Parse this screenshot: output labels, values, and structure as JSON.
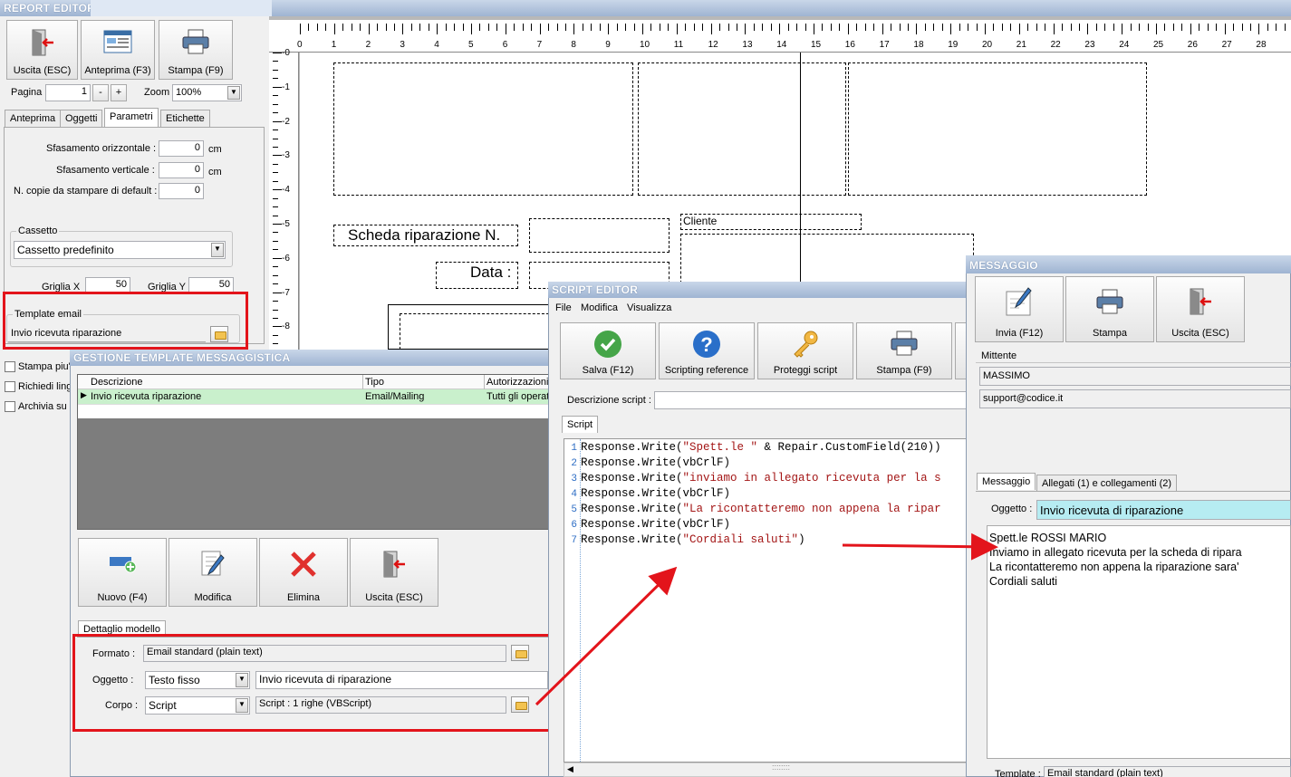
{
  "report_editor": {
    "title": "REPORT EDITOR",
    "buttons": {
      "exit": "Uscita (ESC)",
      "preview": "Anteprima (F3)",
      "print": "Stampa (F9)"
    },
    "page_label": "Pagina",
    "page_value": "1",
    "minus": "-",
    "plus": "+",
    "zoom_label": "Zoom",
    "zoom_value": "100%",
    "tabs": [
      "Anteprima",
      "Oggetti",
      "Parametri",
      "Etichette"
    ],
    "params": {
      "h_offset_label": "Sfasamento orizzontale :",
      "h_offset_value": "0",
      "v_offset_label": "Sfasamento verticale :",
      "v_offset_value": "0",
      "unit": "cm",
      "copies_label": "N. copie da stampare di default :",
      "copies_value": "0",
      "tray_group": "Cassetto",
      "tray_value": "Cassetto predefinito",
      "grid_x_label": "Griglia X",
      "grid_x_value": "50",
      "grid_y_label": "Griglia Y",
      "grid_y_value": "50",
      "template_group": "Template email",
      "template_value": "Invio ricevuta riparazione",
      "check1": "Stampa piu'",
      "check2": "Richiedi lingu",
      "check3": "Archivia su"
    },
    "ruler_top": [
      "0",
      "1",
      "2",
      "3",
      "4",
      "5",
      "6",
      "7",
      "8",
      "9",
      "10",
      "11",
      "12",
      "13",
      "14",
      "15",
      "16",
      "17",
      "18",
      "19",
      "20",
      "21",
      "22",
      "23",
      "24",
      "25",
      "26",
      "27",
      "28"
    ],
    "ruler_left": [
      "0",
      "1",
      "2",
      "3",
      "4",
      "5",
      "6",
      "7",
      "8"
    ],
    "canvas": {
      "scheda_label": "Scheda riparazione N.",
      "data_label": "Data :",
      "cliente_label": "Cliente"
    }
  },
  "gestione": {
    "title": "GESTIONE TEMPLATE MESSAGGISTICA",
    "columns": [
      "Descrizione",
      "Tipo",
      "Autorizzazioni"
    ],
    "rows": [
      {
        "descrizione": "Invio ricevuta riparazione",
        "tipo": "Email/Mailing",
        "autorizzazioni": "Tutti gli operat"
      }
    ],
    "buttons": {
      "new": "Nuovo (F4)",
      "edit": "Modifica",
      "delete": "Elimina",
      "exit": "Uscita (ESC)"
    },
    "detail_tab": "Dettaglio modello",
    "formato_label": "Formato :",
    "formato_value": "Email standard (plain text)",
    "oggetto_label": "Oggetto :",
    "oggetto_type": "Testo fisso",
    "oggetto_value": "Invio ricevuta di riparazione",
    "corpo_label": "Corpo :",
    "corpo_type": "Script",
    "corpo_value": "Script : 1 righe (VBScript)"
  },
  "script_editor": {
    "title": "SCRIPT EDITOR",
    "menu": [
      "File",
      "Modifica",
      "Visualizza"
    ],
    "buttons": {
      "save": "Salva (F12)",
      "reference": "Scripting reference",
      "protect": "Proteggi script",
      "print": "Stampa (F9)"
    },
    "desc_label": "Descrizione script :",
    "tab": "Script",
    "lines": [
      {
        "n": "1",
        "pre": "Response.Write(",
        "str": "\"Spett.le \"",
        "post": " & Repair.CustomField(210))"
      },
      {
        "n": "2",
        "pre": "Response.Write(vbCrlF)",
        "str": "",
        "post": ""
      },
      {
        "n": "3",
        "pre": "Response.Write(",
        "str": "\"inviamo in allegato ricevuta per la s",
        "post": ""
      },
      {
        "n": "4",
        "pre": "Response.Write(vbCrlF)",
        "str": "",
        "post": ""
      },
      {
        "n": "5",
        "pre": "Response.Write(",
        "str": "\"La ricontatteremo non appena la ripar",
        "post": ""
      },
      {
        "n": "6",
        "pre": "Response.Write(vbCrlF)",
        "str": "",
        "post": ""
      },
      {
        "n": "7",
        "pre": "Response.Write(",
        "str": "\"Cordiali saluti\"",
        "post": ")"
      }
    ],
    "status_grip": "::::::::"
  },
  "messaggio": {
    "title": "MESSAGGIO",
    "buttons": {
      "send": "Invia (F12)",
      "print": "Stampa",
      "exit": "Uscita (ESC)"
    },
    "mittente_label": "Mittente",
    "sender_name": "MASSIMO",
    "sender_email": "support@codice.it",
    "tabs": [
      "Messaggio",
      "Allegati (1) e collegamenti (2)"
    ],
    "oggetto_label": "Oggetto :",
    "oggetto_value": "Invio ricevuta di riparazione",
    "body_lines": [
      "Spett.le ROSSI MARIO",
      "Inviamo in allegato ricevuta per la scheda di ripara",
      "La ricontatteremo non appena la riparazione sara'",
      "Cordiali saluti"
    ],
    "template_label": "Template :",
    "template_value": "Email standard (plain text)"
  },
  "colors": {
    "annotation_red": "#e3141b",
    "selected_row": "#c9f0cc",
    "subject_bg": "#b6ecf2"
  }
}
